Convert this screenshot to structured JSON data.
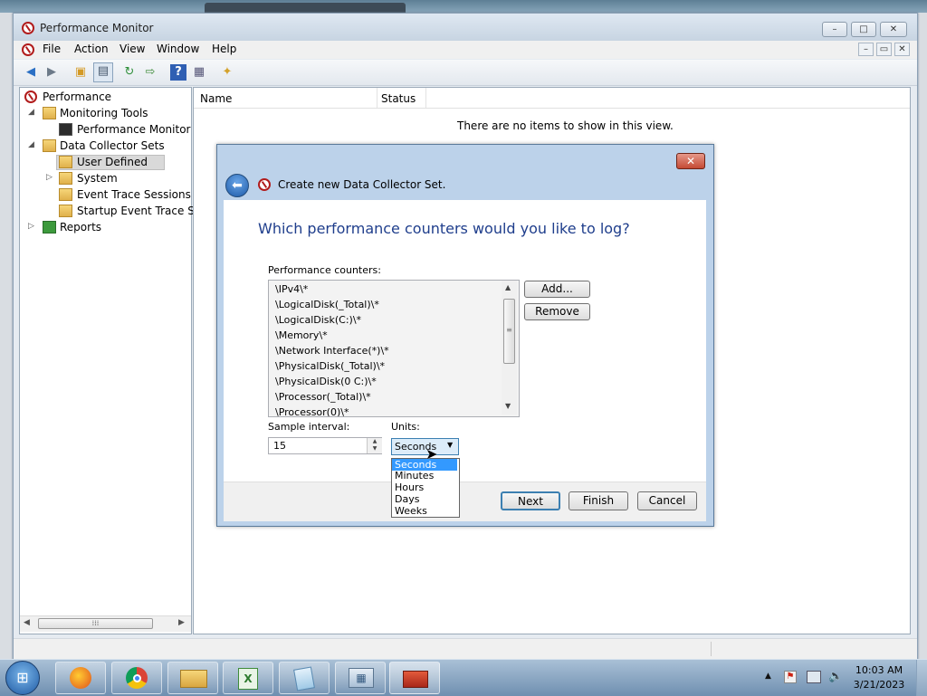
{
  "window": {
    "title": "Performance Monitor",
    "controls": [
      "–",
      "□",
      "✕"
    ]
  },
  "menubar": {
    "items": [
      "File",
      "Action",
      "View",
      "Window",
      "Help"
    ],
    "mdi_controls": [
      "–",
      "▭",
      "✕"
    ]
  },
  "toolbar": {
    "icons": [
      "back-arrow-icon",
      "forward-arrow-icon",
      "up-folder-icon",
      "show-hide-tree-icon",
      "refresh-icon",
      "export-list-icon",
      "help-icon",
      "properties-icon",
      "new-item-icon"
    ]
  },
  "tree": {
    "items": [
      {
        "label": "Performance",
        "icon": "performance-icon"
      },
      {
        "label": "Monitoring Tools",
        "icon": "folder-icon"
      },
      {
        "label": "Performance Monitor",
        "icon": "chart-icon"
      },
      {
        "label": "Data Collector Sets",
        "icon": "folder-icon"
      },
      {
        "label": "User Defined",
        "icon": "user-folder-icon",
        "selected": true
      },
      {
        "label": "System",
        "icon": "system-folder-icon"
      },
      {
        "label": "Event Trace Sessions",
        "icon": "folder-icon"
      },
      {
        "label": "Startup Event Trace Ses",
        "icon": "folder-icon"
      },
      {
        "label": "Reports",
        "icon": "reports-icon"
      }
    ]
  },
  "list": {
    "columns": [
      "Name",
      "Status"
    ],
    "empty_message": "There are no items to show in this view."
  },
  "dialog": {
    "title": "Create new Data Collector Set.",
    "question": "Which performance counters would you like to log?",
    "counters_label": "Performance counters:",
    "counters": [
      "\\IPv4\\*",
      "\\LogicalDisk(_Total)\\*",
      "\\LogicalDisk(C:)\\*",
      "\\Memory\\*",
      "\\Network Interface(*)\\*",
      "\\PhysicalDisk(_Total)\\*",
      "\\PhysicalDisk(0 C:)\\*",
      "\\Processor(_Total)\\*",
      "\\Processor(0)\\*"
    ],
    "add_label": "Add...",
    "remove_label": "Remove",
    "interval_label": "Sample interval:",
    "interval_value": "15",
    "units_label": "Units:",
    "units_value": "Seconds",
    "units_options": [
      "Seconds",
      "Minutes",
      "Hours",
      "Days",
      "Weeks"
    ],
    "next_label": "Next",
    "finish_label": "Finish",
    "cancel_label": "Cancel",
    "close_glyph": "✕"
  },
  "taskbar": {
    "apps": [
      "firefox-icon",
      "chrome-icon",
      "file-explorer-icon",
      "excel-icon",
      "notepad-icon",
      "control-panel-icon",
      "toolbox-icon"
    ],
    "time": "10:03 AM",
    "date": "3/21/2023"
  },
  "colors": {
    "accent": "#1f3e8c",
    "selection": "#3399ff",
    "dialog_frame": "#bcd2ea"
  }
}
